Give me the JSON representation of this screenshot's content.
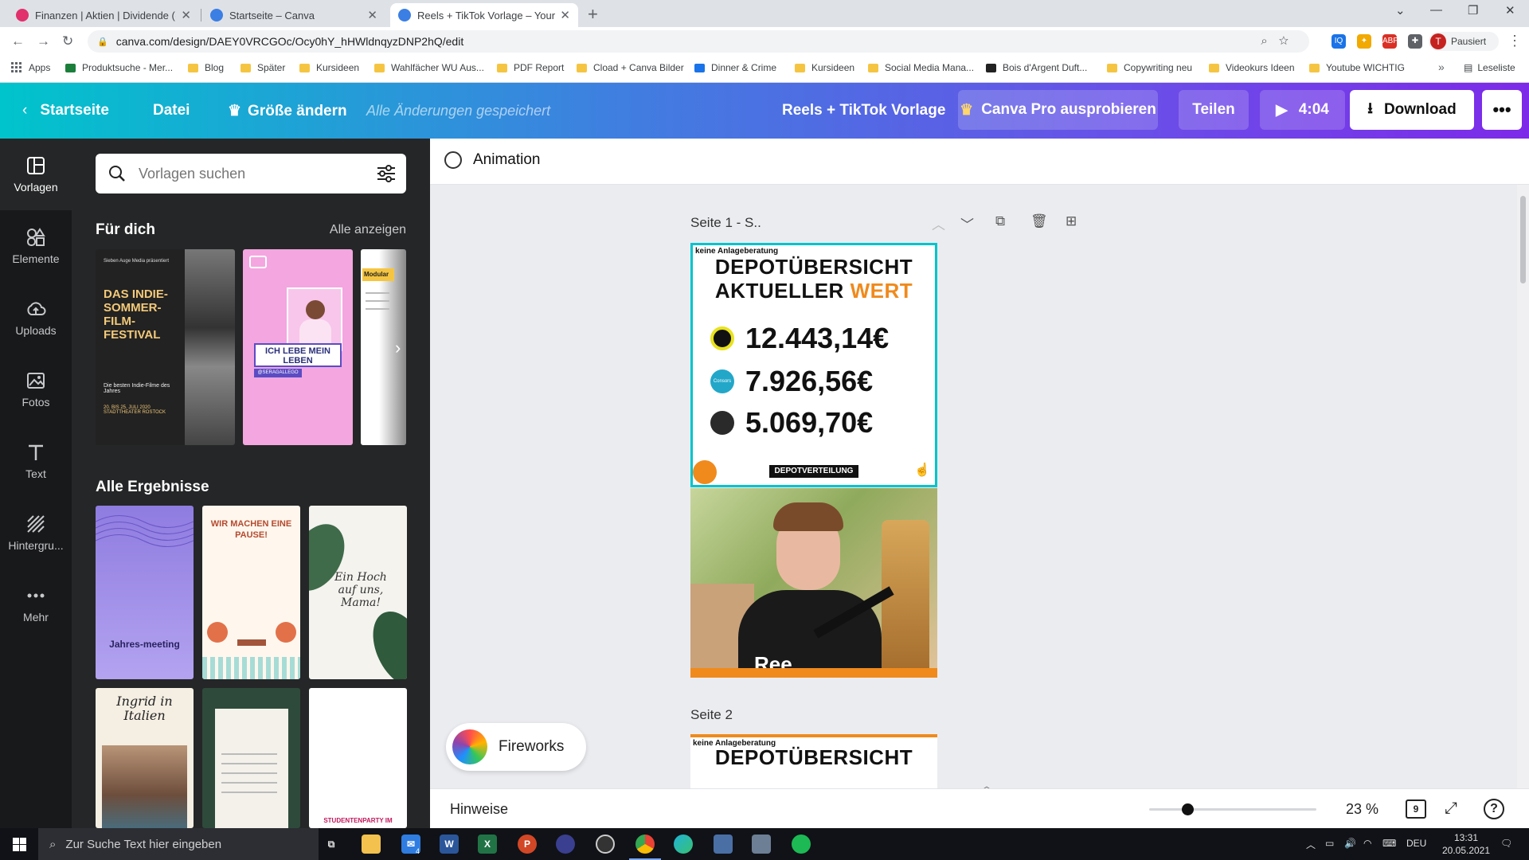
{
  "browser": {
    "tabs": [
      {
        "title": "Finanzen | Aktien | Dividende (@",
        "favicon_color": "#e1306c"
      },
      {
        "title": "Startseite – Canva",
        "favicon_color": "#3b7fe4"
      },
      {
        "title": "Reels + TikTok Vorlage – Your St",
        "favicon_color": "#3b7fe4"
      }
    ],
    "url": "canva.com/design/DAEY0VRCGOc/Ocy0hY_hHWldnqyzDNP2hQ/edit",
    "profile_label": "Pausiert",
    "profile_initial": "T",
    "bookmarks": [
      "Apps",
      "Produktsuche - Mer...",
      "Blog",
      "Später",
      "Kursideen",
      "Wahlfächer WU Aus...",
      "PDF Report",
      "Cload + Canva Bilder",
      "Dinner & Crime",
      "Kursideen",
      "Social Media Mana...",
      "Bois d'Argent Duft...",
      "Copywriting neu",
      "Videokurs Ideen",
      "Youtube WICHTIG"
    ],
    "reading_list": "Leseliste"
  },
  "header": {
    "home": "Startseite",
    "file": "Datei",
    "resize": "Größe ändern",
    "saved_status": "Alle Änderungen gespeichert",
    "design_title": "Reels + TikTok Vorlage",
    "pro_button": "Canva Pro ausprobieren",
    "share_button": "Teilen",
    "play_time": "4:04",
    "download_button": "Download"
  },
  "rail": [
    {
      "label": "Vorlagen"
    },
    {
      "label": "Elemente"
    },
    {
      "label": "Uploads"
    },
    {
      "label": "Fotos"
    },
    {
      "label": "Text"
    },
    {
      "label": "Hintergru..."
    },
    {
      "label": "Mehr"
    }
  ],
  "panel": {
    "search_placeholder": "Vorlagen suchen",
    "section_for_you": "Für dich",
    "show_all": "Alle anzeigen",
    "section_all_results": "Alle Ergebnisse",
    "thumbs": {
      "festival_small": "Sieben Auge Media präsentiert",
      "festival_title": "DAS INDIE-SOMMER-FILM-FESTIVAL",
      "festival_sub": "Die besten Indie-Filme des Jahres",
      "festival_date": "20. BIS 25. JULI 2020 STADTTHEATER ROSTOCK",
      "pink_title": "ICH LEBE MEIN LEBEN",
      "pink_tag": "@SERAGALLEGO",
      "third": "Modular",
      "r1": "Jahres-meeting",
      "r2": "WIR MACHEN EINE PAUSE!",
      "r3": "Ein Hoch auf uns, Mama!",
      "r4": "Ingrid in Italien",
      "r6": "STUDENTENPARTY IM"
    }
  },
  "editor": {
    "animation_label": "Animation",
    "page1_label": "Seite 1 - S..",
    "page2_label": "Seite 2",
    "slide": {
      "disclaimer": "keine Anlageberatung",
      "title_line1": "DEPOTÜBERSICHT",
      "title_line2_a": "AKTUELLER ",
      "title_line2_b": "WERT",
      "values": [
        "12.443,14€",
        "7.926,56€",
        "5.069,70€"
      ],
      "bank_label": "Consors bank",
      "badge": "DEPOTVERTEILUNG"
    },
    "video_caption": "Ree",
    "fireworks_label": "Fireworks",
    "notes_label": "Hinweise",
    "zoom_level": 0.23,
    "zoom_label": "23 %",
    "page_count": "9"
  },
  "taskbar": {
    "search_placeholder": "Zur Suche Text hier eingeben",
    "language": "DEU",
    "time": "13:31",
    "date": "20.05.2021",
    "mail_badge": "4"
  },
  "colors": {
    "accent_teal": "#00c4cc",
    "accent_purple": "#7d2ae8",
    "orange": "#f08a1c"
  }
}
